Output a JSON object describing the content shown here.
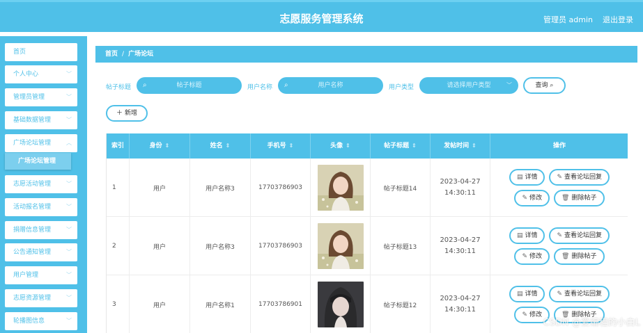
{
  "header": {
    "title": "志愿服务管理系统",
    "user": "管理员 admin",
    "logout": "退出登录"
  },
  "sidebar": {
    "items": [
      {
        "label": "首页",
        "chevron": false
      },
      {
        "label": "个人中心",
        "chevron": true
      },
      {
        "label": "管理员管理",
        "chevron": true
      },
      {
        "label": "基础数据管理",
        "chevron": true
      },
      {
        "label": "广场论坛管理",
        "chevron": true
      },
      {
        "label": "志愿活动管理",
        "chevron": true
      },
      {
        "label": "活动报名管理",
        "chevron": true
      },
      {
        "label": "捐赠信息管理",
        "chevron": true
      },
      {
        "label": "公告通知管理",
        "chevron": true
      },
      {
        "label": "用户管理",
        "chevron": true
      },
      {
        "label": "志愿资源管理",
        "chevron": true
      },
      {
        "label": "轮播图信息",
        "chevron": true
      }
    ],
    "active_sub": "广场论坛管理"
  },
  "breadcrumb": {
    "home": "首页",
    "sep": "/",
    "current": "广场论坛"
  },
  "filters": {
    "title_label": "帖子标题",
    "title_placeholder": "帖子标题",
    "user_label": "用户名称",
    "user_placeholder": "用户名称",
    "type_label": "用户类型",
    "type_placeholder": "请选择用户类型",
    "search_btn": "查询",
    "add_btn": "新增"
  },
  "table": {
    "headers": [
      "索引",
      "身份",
      "姓名",
      "手机号",
      "头像",
      "帖子标题",
      "发帖时间",
      "操作"
    ],
    "rows": [
      {
        "index": "1",
        "role": "用户",
        "name": "用户名称3",
        "phone": "17703786903",
        "title": "帖子标题14",
        "time": "2023-04-27 14:30:11"
      },
      {
        "index": "2",
        "role": "用户",
        "name": "用户名称3",
        "phone": "17703786903",
        "title": "帖子标题13",
        "time": "2023-04-27 14:30:11"
      },
      {
        "index": "3",
        "role": "用户",
        "name": "用户名称1",
        "phone": "17703786901",
        "title": "帖子标题12",
        "time": "2023-04-27 14:30:11"
      }
    ],
    "actions": {
      "detail": "详情",
      "view_reply": "查看论坛回复",
      "edit": "修改",
      "delete": "删除帖子"
    }
  },
  "watermark": "CSDN @爱编程的小白L",
  "colors": {
    "accent": "#4fc0e8"
  }
}
